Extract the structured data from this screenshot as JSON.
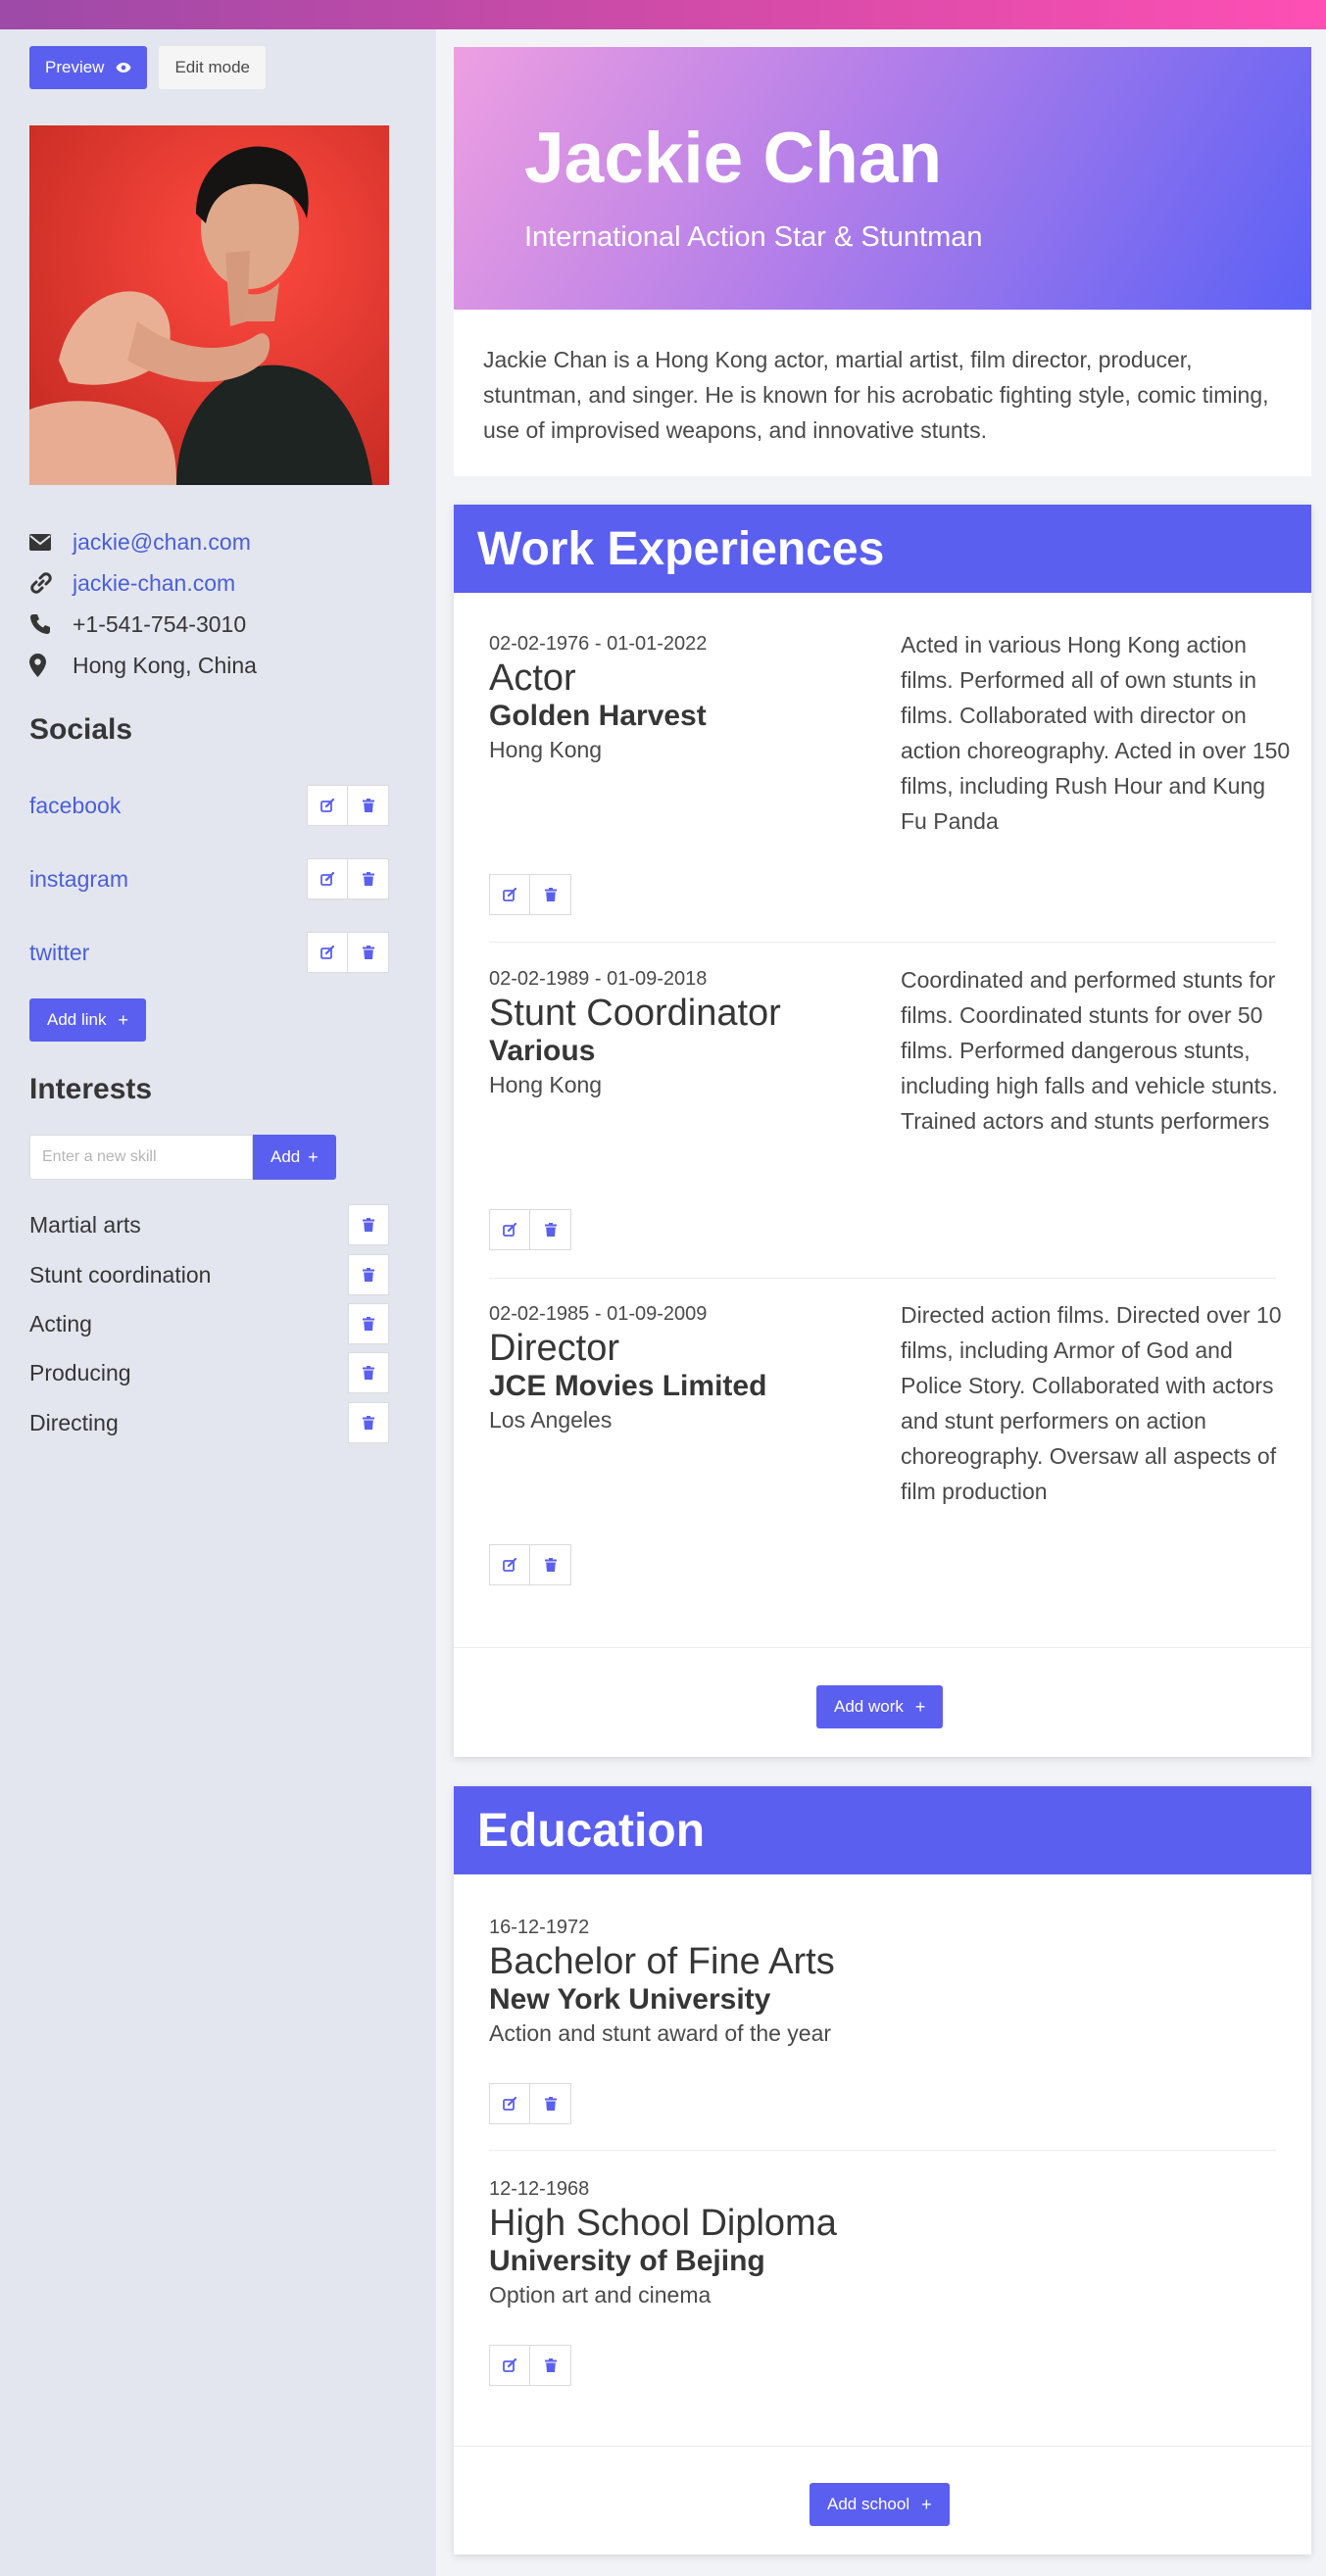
{
  "mode": {
    "preview_label": "Preview",
    "edit_label": "Edit mode"
  },
  "profile": {
    "name": "Jackie Chan",
    "tagline": "International Action Star & Stuntman",
    "bio": "Jackie Chan is a Hong Kong actor, martial artist, film director, producer, stuntman, and singer. He is known for his acrobatic fighting style, comic timing, use of improvised weapons, and innovative stunts."
  },
  "contact": {
    "email": "jackie@chan.com",
    "website": "jackie-chan.com",
    "phone": "+1-541-754-3010",
    "location": "Hong Kong, China"
  },
  "socials": {
    "title": "Socials",
    "items": [
      {
        "name": "facebook"
      },
      {
        "name": "instagram"
      },
      {
        "name": "twitter"
      }
    ],
    "add_label": "Add link"
  },
  "interests": {
    "title": "Interests",
    "placeholder": "Enter a new skill",
    "add_label": "Add",
    "items": [
      "Martial arts",
      "Stunt coordination",
      "Acting",
      "Producing",
      "Directing"
    ]
  },
  "work": {
    "title": "Work Experiences",
    "add_label": "Add work",
    "items": [
      {
        "dates": "02-02-1976 - 01-01-2022",
        "title": "Actor",
        "org": "Golden Harvest",
        "place": "Hong Kong",
        "desc": "Acted in various Hong Kong action films. Performed all of own stunts in films. Collaborated with director on action choreography. Acted in over 150 films, including Rush Hour and Kung Fu Panda"
      },
      {
        "dates": "02-02-1989 - 01-09-2018",
        "title": "Stunt Coordinator",
        "org": "Various",
        "place": "Hong Kong",
        "desc": "Coordinated and performed stunts for films. Coordinated stunts for over 50 films. Performed dangerous stunts, including high falls and vehicle stunts. Trained actors and stunts performers"
      },
      {
        "dates": "02-02-1985 - 01-09-2009",
        "title": "Director",
        "org": "JCE Movies Limited",
        "place": "Los Angeles",
        "desc": "Directed action films. Directed over 10 films, including Armor of God and Police Story. Collaborated with actors and stunt performers on action choreography. Oversaw all aspects of film production"
      }
    ]
  },
  "education": {
    "title": "Education",
    "add_label": "Add school",
    "items": [
      {
        "date": "16-12-1972",
        "degree": "Bachelor of Fine Arts",
        "school": "New York University",
        "note": "Action and stunt award of the year"
      },
      {
        "date": "12-12-1968",
        "degree": "High School Diploma",
        "school": "University of Bejing",
        "note": "Option art and cinema"
      }
    ]
  },
  "colors": {
    "primary": "#5b5ff0",
    "link": "#4a5fd8",
    "sidebar_bg": "#e3e6ee",
    "hero_gradient_start": "#ee9fe1",
    "hero_gradient_end": "#5b61f5"
  }
}
